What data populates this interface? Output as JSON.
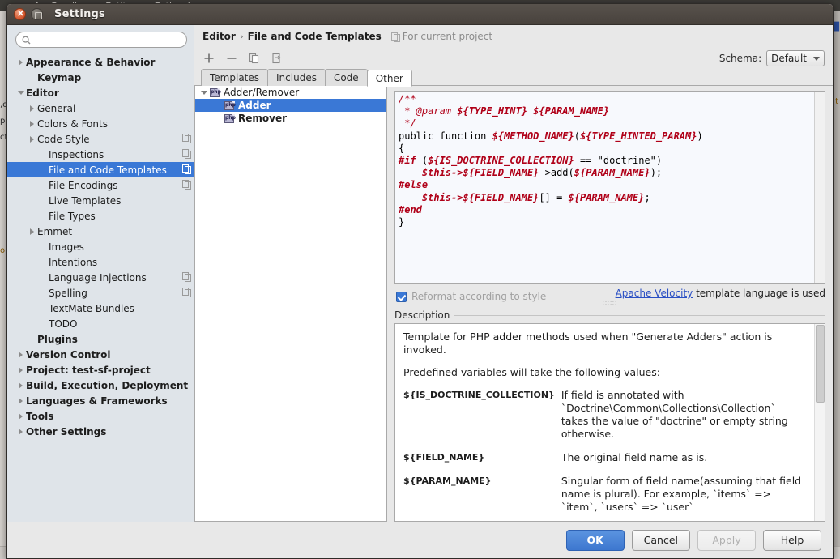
{
  "background": {
    "breadcrumbs": [
      "AppBundle",
      "Entity",
      "Entity.php"
    ],
    "left_fragments": [
      ",c",
      "p",
      "ct",
      "or"
    ],
    "right_fragments": [
      "t"
    ]
  },
  "window": {
    "title": "Settings",
    "close_icon": "close-icon",
    "maximize_icon": "maximize-icon"
  },
  "search": {
    "placeholder": "",
    "value": "",
    "icon": "search-icon"
  },
  "sidebar": {
    "items": [
      {
        "label": "Appearance & Behavior",
        "indent": 0,
        "bold": true,
        "arrow": "collapsed",
        "config": false,
        "selected": false
      },
      {
        "label": "Keymap",
        "indent": 1,
        "bold": true,
        "arrow": "none",
        "config": false,
        "selected": false
      },
      {
        "label": "Editor",
        "indent": 0,
        "bold": true,
        "arrow": "expanded",
        "config": false,
        "selected": false
      },
      {
        "label": "General",
        "indent": 1,
        "bold": false,
        "arrow": "collapsed",
        "config": false,
        "selected": false
      },
      {
        "label": "Colors & Fonts",
        "indent": 1,
        "bold": false,
        "arrow": "collapsed",
        "config": false,
        "selected": false
      },
      {
        "label": "Code Style",
        "indent": 1,
        "bold": false,
        "arrow": "collapsed",
        "config": true,
        "selected": false
      },
      {
        "label": "Inspections",
        "indent": 2,
        "bold": false,
        "arrow": "none",
        "config": true,
        "selected": false
      },
      {
        "label": "File and Code Templates",
        "indent": 2,
        "bold": false,
        "arrow": "none",
        "config": true,
        "selected": true
      },
      {
        "label": "File Encodings",
        "indent": 2,
        "bold": false,
        "arrow": "none",
        "config": true,
        "selected": false
      },
      {
        "label": "Live Templates",
        "indent": 2,
        "bold": false,
        "arrow": "none",
        "config": false,
        "selected": false
      },
      {
        "label": "File Types",
        "indent": 2,
        "bold": false,
        "arrow": "none",
        "config": false,
        "selected": false
      },
      {
        "label": "Emmet",
        "indent": 1,
        "bold": false,
        "arrow": "collapsed",
        "config": false,
        "selected": false
      },
      {
        "label": "Images",
        "indent": 2,
        "bold": false,
        "arrow": "none",
        "config": false,
        "selected": false
      },
      {
        "label": "Intentions",
        "indent": 2,
        "bold": false,
        "arrow": "none",
        "config": false,
        "selected": false
      },
      {
        "label": "Language Injections",
        "indent": 2,
        "bold": false,
        "arrow": "none",
        "config": true,
        "selected": false
      },
      {
        "label": "Spelling",
        "indent": 2,
        "bold": false,
        "arrow": "none",
        "config": true,
        "selected": false
      },
      {
        "label": "TextMate Bundles",
        "indent": 2,
        "bold": false,
        "arrow": "none",
        "config": false,
        "selected": false
      },
      {
        "label": "TODO",
        "indent": 2,
        "bold": false,
        "arrow": "none",
        "config": false,
        "selected": false
      },
      {
        "label": "Plugins",
        "indent": 1,
        "bold": true,
        "arrow": "none",
        "config": false,
        "selected": false
      },
      {
        "label": "Version Control",
        "indent": 0,
        "bold": true,
        "arrow": "collapsed",
        "config": false,
        "selected": false
      },
      {
        "label": "Project: test-sf-project",
        "indent": 0,
        "bold": true,
        "arrow": "collapsed",
        "config": false,
        "selected": false
      },
      {
        "label": "Build, Execution, Deployment",
        "indent": 0,
        "bold": true,
        "arrow": "collapsed",
        "config": false,
        "selected": false
      },
      {
        "label": "Languages & Frameworks",
        "indent": 0,
        "bold": true,
        "arrow": "collapsed",
        "config": false,
        "selected": false
      },
      {
        "label": "Tools",
        "indent": 0,
        "bold": true,
        "arrow": "collapsed",
        "config": false,
        "selected": false
      },
      {
        "label": "Other Settings",
        "indent": 0,
        "bold": true,
        "arrow": "collapsed",
        "config": false,
        "selected": false
      }
    ]
  },
  "breadcrumb": {
    "parent": "Editor",
    "separator": "›",
    "current": "File and Code Templates",
    "scope": "For current project",
    "scope_icon": "scope-icon"
  },
  "toolbar": {
    "add_icon": "plus-icon",
    "remove_icon": "minus-icon",
    "copy_icon": "copy-icon",
    "reset_icon": "reset-icon",
    "schema_label": "Schema:",
    "schema_value": "Default"
  },
  "tabs": [
    {
      "label": "Templates",
      "active": false
    },
    {
      "label": "Includes",
      "active": false
    },
    {
      "label": "Code",
      "active": false
    },
    {
      "label": "Other",
      "active": true
    }
  ],
  "template_tree": [
    {
      "label": "Adder/Remover",
      "level": 0,
      "arrow": "expanded",
      "icon": "php-file-icon",
      "selected": false
    },
    {
      "label": "Adder",
      "level": 1,
      "arrow": "none",
      "icon": "php-file-icon",
      "selected": true
    },
    {
      "label": "Remover",
      "level": 1,
      "arrow": "none",
      "icon": "php-file-icon",
      "selected": false
    }
  ],
  "editor": {
    "lines": [
      [
        {
          "t": "/**",
          "c": "cmt"
        }
      ],
      [
        {
          "t": " * @param ",
          "c": "cmt"
        },
        {
          "t": "${TYPE_HINT} ${PARAM_NAME}",
          "c": "var"
        }
      ],
      [
        {
          "t": " */",
          "c": "cmt"
        }
      ],
      [
        {
          "t": "public function ",
          "c": "kw"
        },
        {
          "t": "${METHOD_NAME}",
          "c": "var"
        },
        {
          "t": "(",
          "c": "kw"
        },
        {
          "t": "${TYPE_HINTED_PARAM}",
          "c": "var"
        },
        {
          "t": ")",
          "c": "kw"
        }
      ],
      [
        {
          "t": "{",
          "c": "kw"
        }
      ],
      [
        {
          "t": "#if",
          "c": "dir"
        },
        {
          "t": " (",
          "c": "kw"
        },
        {
          "t": "${IS_DOCTRINE_COLLECTION}",
          "c": "var"
        },
        {
          "t": " == \"doctrine\")",
          "c": "kw"
        }
      ],
      [
        {
          "t": "    ",
          "c": "kw"
        },
        {
          "t": "$this->${FIELD_NAME}",
          "c": "var"
        },
        {
          "t": "->add(",
          "c": "kw"
        },
        {
          "t": "${PARAM_NAME}",
          "c": "var"
        },
        {
          "t": ");",
          "c": "kw"
        }
      ],
      [
        {
          "t": "#else",
          "c": "dir"
        }
      ],
      [
        {
          "t": "    ",
          "c": "kw"
        },
        {
          "t": "$this->${FIELD_NAME}",
          "c": "var"
        },
        {
          "t": "[] = ",
          "c": "kw"
        },
        {
          "t": "${PARAM_NAME}",
          "c": "var"
        },
        {
          "t": ";",
          "c": "kw"
        }
      ],
      [
        {
          "t": "#end",
          "c": "dir"
        }
      ],
      [
        {
          "t": "}",
          "c": "kw"
        }
      ]
    ]
  },
  "reformat": {
    "label": "Reformat according to style",
    "checked": true,
    "link": "Apache Velocity",
    "note_suffix": " template language is used"
  },
  "description": {
    "title": "Description",
    "paragraphs": [
      "Template for PHP adder methods used when \"Generate Adders\" action is invoked.",
      "Predefined variables will take the following values:"
    ],
    "variables": [
      {
        "name": "${IS_DOCTRINE_COLLECTION}",
        "desc": "If field is annotated with `Doctrine\\Common\\Collections\\Collection` takes the value of \"doctrine\" or empty string otherwise."
      },
      {
        "name": "${FIELD_NAME}",
        "desc": "The original field name as is."
      },
      {
        "name": "${PARAM_NAME}",
        "desc": "Singular form of field name(assuming that field name is plural). For example, `items` => `item`, `users` => `user`"
      }
    ]
  },
  "footer": {
    "ok": "OK",
    "cancel": "Cancel",
    "apply": "Apply",
    "help": "Help",
    "apply_disabled": true
  },
  "colors": {
    "accent": "#3a78d6",
    "variable": "#b00018",
    "link": "#2a4fc4",
    "titlebar": "#4f4942"
  }
}
